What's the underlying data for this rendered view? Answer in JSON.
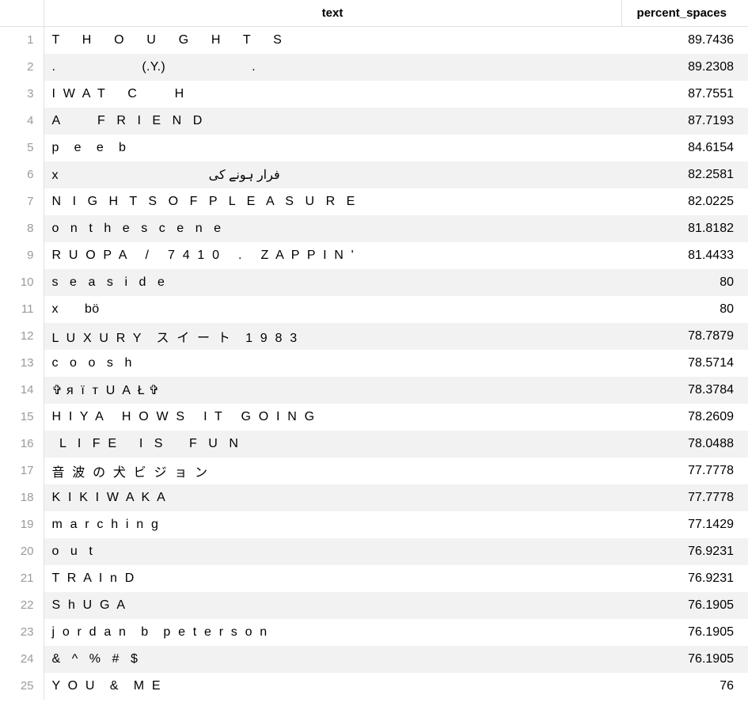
{
  "columns": {
    "text": "text",
    "percent_spaces": "percent_spaces"
  },
  "rows": [
    {
      "idx": "1",
      "text": "T      H      O      U      G      H      T      S",
      "percent_spaces": "89.7436"
    },
    {
      "idx": "2",
      "text": ".                       (.Y.)                       .",
      "percent_spaces": "89.2308"
    },
    {
      "idx": "3",
      "text": "I  W  A  T      C          H",
      "percent_spaces": "87.7551"
    },
    {
      "idx": "4",
      "text": "A          F   R   I   E   N   D",
      "percent_spaces": "87.7193"
    },
    {
      "idx": "5",
      "text": "p    e    e    b",
      "percent_spaces": "84.6154"
    },
    {
      "idx": "6",
      "text": "x                                        فرار ہونے کی",
      "percent_spaces": "82.2581"
    },
    {
      "idx": "7",
      "text": "N   I   G   H   T   S   O   F   P   L   E   A   S   U   R   E",
      "percent_spaces": "82.0225"
    },
    {
      "idx": "8",
      "text": "o   n   t   h   e   s   c   e   n   e",
      "percent_spaces": "81.8182"
    },
    {
      "idx": "9",
      "text": "R  U  O  P  A     /     7  4  1  0     .     Z  A  P  P  I  N  '",
      "percent_spaces": "81.4433"
    },
    {
      "idx": "10",
      "text": "s   e   a   s   i   d   e",
      "percent_spaces": "80"
    },
    {
      "idx": "11",
      "text": "x       bö",
      "percent_spaces": "80"
    },
    {
      "idx": "12",
      "text": "L  U  X  U  R  Y    ス  イ  ー  ト    1  9  8  3",
      "percent_spaces": "78.7879"
    },
    {
      "idx": "13",
      "text": "c   o   o   s   h",
      "percent_spaces": "78.5714"
    },
    {
      "idx": "14",
      "text": "✞ я  ї  т  U  A  Ł ✞",
      "percent_spaces": "78.3784"
    },
    {
      "idx": "15",
      "text": "H  I  Y  A     H  O  W  S     I  T     G  O  I  N  G",
      "percent_spaces": "78.2609"
    },
    {
      "idx": "16",
      "text": "  L   I   F  E      I   S       F   U   N",
      "percent_spaces": "78.0488"
    },
    {
      "idx": "17",
      "text": "音  波  の  犬  ビ  ジ  ョ  ン",
      "percent_spaces": "77.7778"
    },
    {
      "idx": "18",
      "text": "K  I  K  I  W  A  K  A",
      "percent_spaces": "77.7778"
    },
    {
      "idx": "19",
      "text": "m  a  r  c  h  i  n  g",
      "percent_spaces": "77.1429"
    },
    {
      "idx": "20",
      "text": "o   u   t",
      "percent_spaces": "76.9231"
    },
    {
      "idx": "21",
      "text": "T  R  A  I  n  D",
      "percent_spaces": "76.9231"
    },
    {
      "idx": "22",
      "text": "S  h  U  G  A",
      "percent_spaces": "76.1905"
    },
    {
      "idx": "23",
      "text": "j  o  r  d  a  n    b    p  e  t  e  r  s  o  n",
      "percent_spaces": "76.1905"
    },
    {
      "idx": "24",
      "text": "&   ^   %   #   $",
      "percent_spaces": "76.1905"
    },
    {
      "idx": "25",
      "text": "Y  O  U    &    M  E",
      "percent_spaces": "76"
    }
  ]
}
